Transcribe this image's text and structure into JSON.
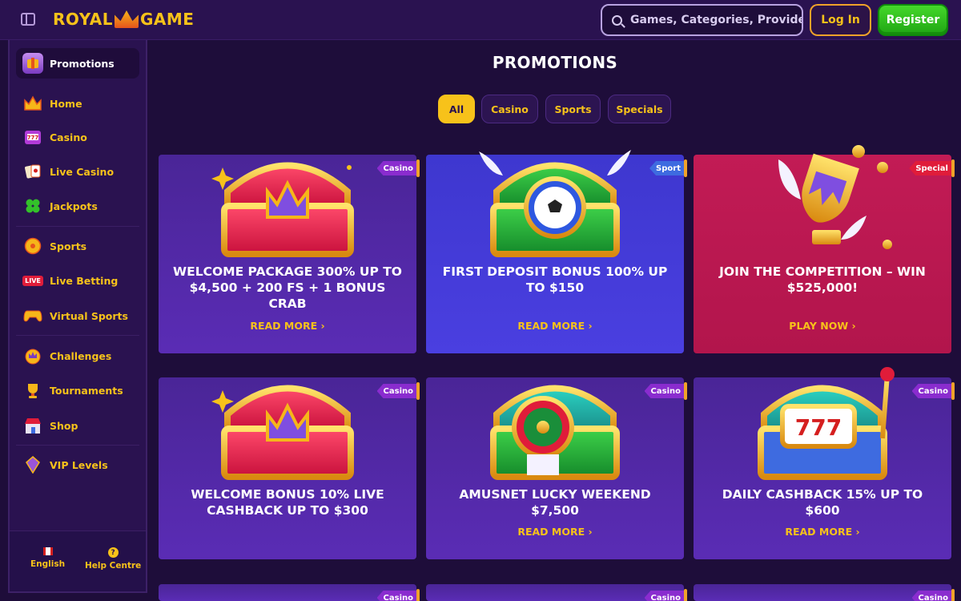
{
  "header": {
    "logo_left": "ROYAL",
    "logo_right": "GAME",
    "search_placeholder": "Games, Categories, Providers",
    "login_label": "Log In",
    "register_label": "Register"
  },
  "sidebar": {
    "items": [
      {
        "label": "Promotions",
        "icon": "promotions-icon"
      },
      {
        "label": "Home",
        "icon": "home-crown-icon"
      },
      {
        "label": "Casino",
        "icon": "slot-machine-icon"
      },
      {
        "label": "Live Casino",
        "icon": "playing-cards-icon"
      },
      {
        "label": "Jackpots",
        "icon": "clover-icon"
      },
      {
        "label": "Sports",
        "icon": "ball-icon"
      },
      {
        "label": "Live Betting",
        "icon": "live-badge-icon"
      },
      {
        "label": "Virtual Sports",
        "icon": "gamepad-icon"
      },
      {
        "label": "Challenges",
        "icon": "challenge-medal-icon"
      },
      {
        "label": "Tournaments",
        "icon": "trophy-icon"
      },
      {
        "label": "Shop",
        "icon": "shop-icon"
      },
      {
        "label": "VIP Levels",
        "icon": "vip-icon"
      }
    ],
    "live_text": "LIVE",
    "footer": {
      "language": "English",
      "help": "Help Centre"
    }
  },
  "main": {
    "title": "PROMOTIONS",
    "filters": [
      "All",
      "Casino",
      "Sports",
      "Specials"
    ],
    "active_filter": "All",
    "cards": [
      {
        "badge": "Casino",
        "title": "WELCOME PACKAGE 300% UP TO $4,500 + 200 FS + 1 BONUS CRAB",
        "cta": "READ MORE",
        "theme": "purple"
      },
      {
        "badge": "Sport",
        "title": "FIRST DEPOSIT BONUS 100% UP TO $150",
        "cta": "READ MORE",
        "theme": "blue"
      },
      {
        "badge": "Special",
        "title": "JOIN THE COMPETITION – WIN $525,000!",
        "cta": "PLAY NOW",
        "theme": "red"
      },
      {
        "badge": "Casino",
        "title": "WELCOME BONUS 10% LIVE CASHBACK UP TO $300",
        "cta": "",
        "theme": "purple"
      },
      {
        "badge": "Casino",
        "title": "AMUSNET LUCKY WEEKEND $7,500",
        "cta": "READ MORE",
        "theme": "purple"
      },
      {
        "badge": "Casino",
        "title": "DAILY CASHBACK 15% UP TO $600",
        "cta": "READ MORE",
        "theme": "purple"
      },
      {
        "badge": "Casino",
        "title": "",
        "cta": "",
        "theme": "purple"
      },
      {
        "badge": "Casino",
        "title": "",
        "cta": "",
        "theme": "purple"
      },
      {
        "badge": "Casino",
        "title": "",
        "cta": "",
        "theme": "purple"
      }
    ]
  },
  "colors": {
    "accent": "#f7c21a",
    "background": "#1e0d3a",
    "register": "#2fc51c"
  }
}
